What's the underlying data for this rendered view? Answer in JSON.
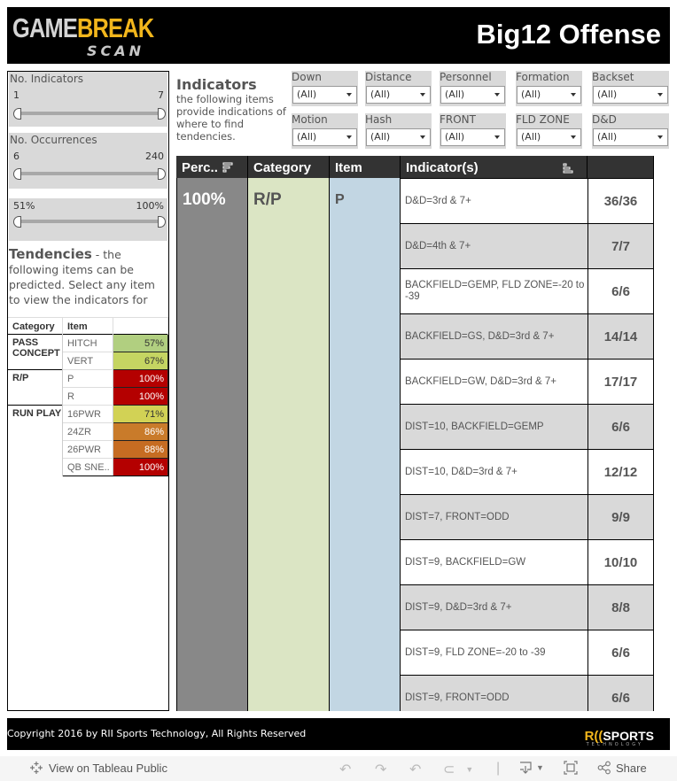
{
  "header": {
    "logo": {
      "word1": "GAME",
      "word2": "BREAK",
      "word3": "SCAN"
    },
    "title": "Big12 Offense"
  },
  "sliders": [
    {
      "label": "No. Indicators",
      "min": "1",
      "max": "7"
    },
    {
      "label": "No. Occurrences",
      "min": "6",
      "max": "240"
    },
    {
      "label": "",
      "min": "51%",
      "max": "100%"
    }
  ],
  "tendencies": {
    "title": "Tendencies",
    "description": " - the following items can be predicted.  Select any item to view the indicators for each.",
    "columns": [
      "Category",
      "Item",
      ""
    ],
    "groups": [
      {
        "category": "PASS CONCEPT",
        "rows": [
          {
            "item": "HITCH",
            "pct": "57%",
            "color": "#b1cf80",
            "text_color": "#333333"
          },
          {
            "item": "VERT",
            "pct": "67%",
            "color": "#c5d562",
            "text_color": "#333333"
          }
        ]
      },
      {
        "category": "R/P",
        "rows": [
          {
            "item": "P",
            "pct": "100%",
            "color": "#b40000",
            "text_color": "#ffffff"
          },
          {
            "item": "R",
            "pct": "100%",
            "color": "#b40000",
            "text_color": "#ffffff"
          }
        ]
      },
      {
        "category": "RUN PLAY",
        "rows": [
          {
            "item": "16PWR",
            "pct": "71%",
            "color": "#d2d255",
            "text_color": "#333333"
          },
          {
            "item": "24ZR",
            "pct": "86%",
            "color": "#c97b2a",
            "text_color": "#ffffff"
          },
          {
            "item": "26PWR",
            "pct": "88%",
            "color": "#c66c22",
            "text_color": "#ffffff"
          },
          {
            "item": "QB SNE..",
            "pct": "100%",
            "color": "#b40000",
            "text_color": "#ffffff"
          }
        ]
      }
    ]
  },
  "indicators": {
    "title": "Indicators",
    "description": "the following items provide indications of where to find tendencies."
  },
  "filters": [
    {
      "label": "Down",
      "value": "(All)"
    },
    {
      "label": "Distance",
      "value": "(All)"
    },
    {
      "label": "Personnel",
      "value": "(All)"
    },
    {
      "label": "Formation",
      "value": "(All)"
    },
    {
      "label": "Backset",
      "value": "(All)"
    },
    {
      "label": "Motion",
      "value": "(All)"
    },
    {
      "label": "Hash",
      "value": "(All)"
    },
    {
      "label": "FRONT",
      "value": "(All)"
    },
    {
      "label": "FLD ZONE",
      "value": "(All)"
    },
    {
      "label": "D&D",
      "value": "(All)"
    }
  ],
  "main_table": {
    "columns": [
      "Perc..",
      "Category",
      "Item",
      "Indicator(s)",
      ""
    ],
    "percent": "100%",
    "category": "R/P",
    "item": "P",
    "rows": [
      {
        "indicator": "D&D=3rd & 7+",
        "count": "36/36"
      },
      {
        "indicator": "D&D=4th & 7+",
        "count": "7/7"
      },
      {
        "indicator": "BACKFIELD=GEMP, FLD ZONE=-20 to -39",
        "count": "6/6"
      },
      {
        "indicator": "BACKFIELD=GS, D&D=3rd & 7+",
        "count": "14/14"
      },
      {
        "indicator": "BACKFIELD=GW, D&D=3rd & 7+",
        "count": "17/17"
      },
      {
        "indicator": "DIST=10, BACKFIELD=GEMP",
        "count": "6/6"
      },
      {
        "indicator": "DIST=10, D&D=3rd & 7+",
        "count": "12/12"
      },
      {
        "indicator": "DIST=7, FRONT=ODD",
        "count": "9/9"
      },
      {
        "indicator": "DIST=9, BACKFIELD=GW",
        "count": "10/10"
      },
      {
        "indicator": "DIST=9, D&D=3rd & 7+",
        "count": "8/8"
      },
      {
        "indicator": "DIST=9, FLD ZONE=-20 to -39",
        "count": "6/6"
      },
      {
        "indicator": "DIST=9, FRONT=ODD",
        "count": "6/6"
      }
    ]
  },
  "footer": {
    "copyright": "Copyright 2016 by RII Sports Technology, All Rights Reserved",
    "brand_r": "R((",
    "brand_sports": "SPORTS",
    "brand_tech": "TECHNOLOGY"
  },
  "toolbar": {
    "view_on": "View on Tableau Public",
    "share": "Share"
  }
}
